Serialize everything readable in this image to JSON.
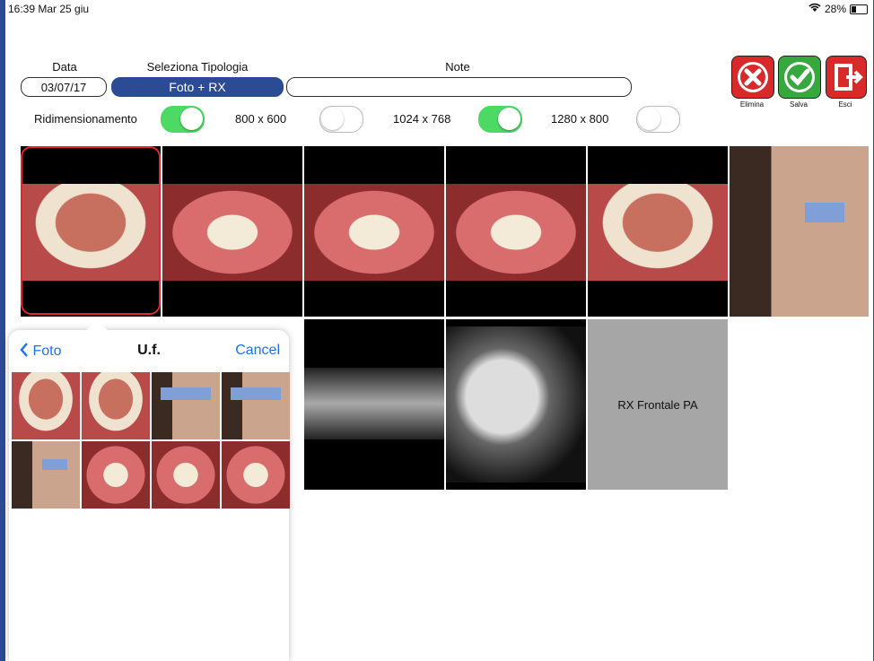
{
  "status": {
    "time": "16:39  Mar 25 giu",
    "battery": "28%"
  },
  "header": {
    "data_label": "Data",
    "date_value": "03/07/17",
    "tipologia_label": "Seleziona Tipologia",
    "tipologia_value": "Foto + RX",
    "note_label": "Note",
    "note_value": ""
  },
  "resize": {
    "label": "Ridimensionamento",
    "label_on": true,
    "options": [
      {
        "label": "800 x 600",
        "on": false
      },
      {
        "label": "1024 x 768",
        "on": true
      },
      {
        "label": "1280 x 800",
        "on": false
      }
    ]
  },
  "actions": {
    "delete": "Elimina",
    "save": "Salva",
    "exit": "Esci"
  },
  "gallery": {
    "rx_frontal": "RX Frontale PA"
  },
  "picker": {
    "back": "Foto",
    "title": "U.f.",
    "cancel": "Cancel"
  },
  "colors": {
    "accent": "#2b4b94",
    "toggle_on": "#4cd964",
    "selected": "#e0282f",
    "link": "#1a73e8"
  }
}
